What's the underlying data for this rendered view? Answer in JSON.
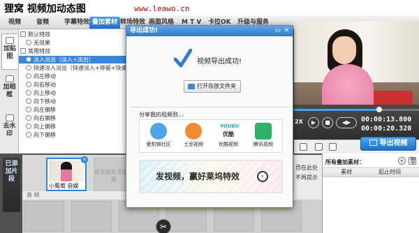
{
  "watermark": {
    "title": "狸窝 视频加动态图",
    "url": "www.leawo.cn"
  },
  "tabs": [
    {
      "label": "视频"
    },
    {
      "label": "音频"
    },
    {
      "label": "字幕特效"
    },
    {
      "label": "叠加素材",
      "active": true
    },
    {
      "label": "转场特效"
    },
    {
      "label": "画面风格"
    },
    {
      "label": "M T V"
    },
    {
      "label": "卡拉OK"
    },
    {
      "label": "升级与服务"
    }
  ],
  "side_tabs": [
    {
      "label": "加贴图",
      "active": true
    },
    {
      "label": "加相框"
    },
    {
      "label": "去水印"
    }
  ],
  "tree": [
    {
      "label": "默认特效",
      "type": "group"
    },
    {
      "label": "无效果",
      "type": "item"
    },
    {
      "label": "常用特效",
      "type": "group"
    },
    {
      "label": "淡入淡出（淡入+淡出）",
      "type": "item",
      "selected": true
    },
    {
      "label": "快速淡入淡出（快速淡入+停留+快速淡出）",
      "type": "item"
    },
    {
      "label": "向左移动",
      "type": "item"
    },
    {
      "label": "向右移动",
      "type": "item"
    },
    {
      "label": "向上移动",
      "type": "item"
    },
    {
      "label": "向下移动",
      "type": "item"
    },
    {
      "label": "向左偏移",
      "type": "item"
    },
    {
      "label": "向右偏移",
      "type": "item"
    },
    {
      "label": "向上偏移",
      "type": "item"
    },
    {
      "label": "向下偏移",
      "type": "item"
    }
  ],
  "player": {
    "zoom_label": "2X",
    "current_time": "00:00:13.800",
    "total_time": "00:00:20.320",
    "progress": 0.68
  },
  "export_button": "导出视频",
  "timeline": {
    "video_label": "已添加片段",
    "clip_caption": "小葡萄 自娱",
    "empty_slot_label": "双击此处添加视频",
    "audio_label": "音 频"
  },
  "behind_text": {
    "line1": "页在此处",
    "line2": "不再提示"
  },
  "subtitle_panel": {
    "header": "所有叠加素材：",
    "col_material": "素材",
    "col_start": "起止时间"
  },
  "modal": {
    "title": "导出成功!",
    "success_text": "视频导出成功!",
    "open_folder": "打开存放文件夹",
    "share_title": "分享我的视频到...",
    "share_items": [
      {
        "label": "爱剪辑社区",
        "color": "#4fa3e8"
      },
      {
        "label": "土豆视频",
        "color": "#f08a35"
      },
      {
        "label": "优酷视频",
        "color": "#2aa3e0"
      },
      {
        "label": "腾讯视频",
        "color": "#29b36a"
      }
    ],
    "youku_logo": "YOUKU",
    "youku_cn": "优酷",
    "banner_text": "发视频，赢好莱坞特效"
  }
}
